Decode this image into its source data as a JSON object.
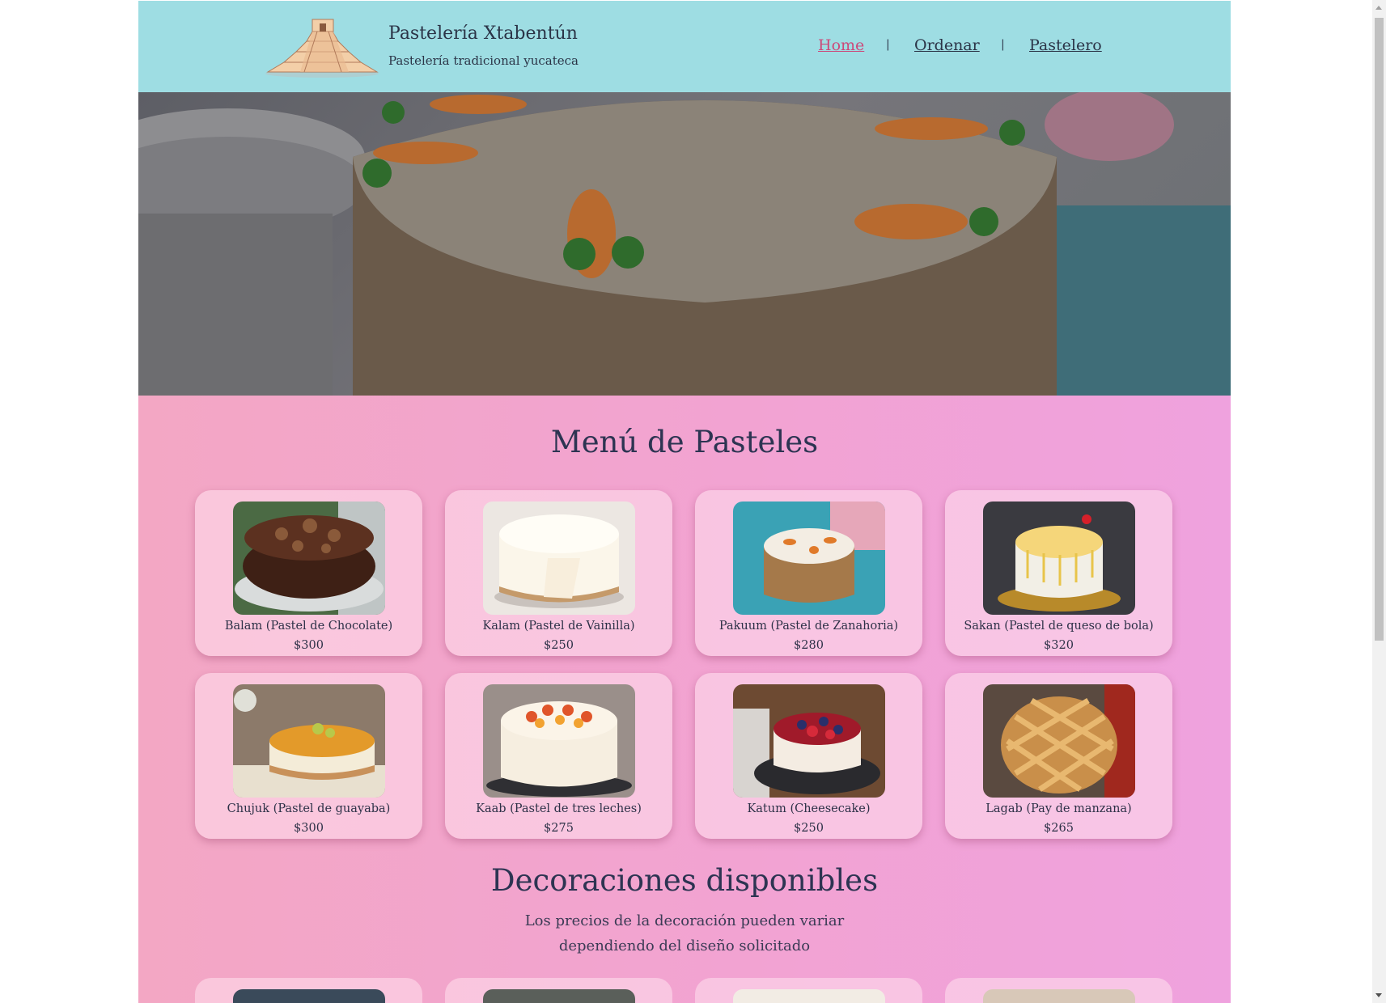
{
  "header": {
    "title": "Pastelería Xtabentún",
    "subtitle": "Pastelería tradicional yucateca",
    "nav": [
      {
        "label": "Home"
      },
      {
        "label": "Ordenar"
      },
      {
        "label": "Pastelero"
      }
    ],
    "separator": "|"
  },
  "menu": {
    "title": "Menú de Pasteles",
    "items": [
      {
        "name": "Balam (Pastel de Chocolate)",
        "price": "$300"
      },
      {
        "name": "Kalam (Pastel de Vainilla)",
        "price": "$250"
      },
      {
        "name": "Pakuum (Pastel de Zanahoria)",
        "price": "$280"
      },
      {
        "name": "Sakan (Pastel de queso de bola)",
        "price": "$320"
      },
      {
        "name": "Chujuk (Pastel de guayaba)",
        "price": "$300"
      },
      {
        "name": "Kaab (Pastel de tres leches)",
        "price": "$275"
      },
      {
        "name": "Katum (Cheesecake)",
        "price": "$250"
      },
      {
        "name": "Lagab (Pay de manzana)",
        "price": "$265"
      }
    ]
  },
  "decorations": {
    "title": "Decoraciones disponibles",
    "desc_line1": "Los precios de la decoración pueden variar",
    "desc_line2": "dependiendo del diseño solicitado"
  },
  "colors": {
    "header_bg": "#9edde3",
    "nav_active": "#cc4a7a",
    "text_dark": "#2b3447"
  }
}
